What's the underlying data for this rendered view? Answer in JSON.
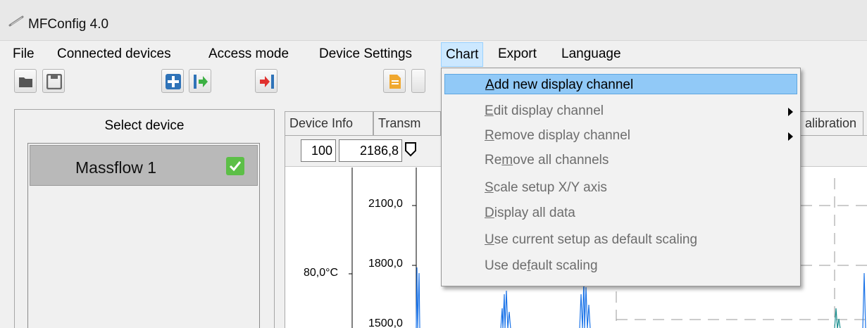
{
  "window": {
    "title": "MFConfig 4.0"
  },
  "menubar": [
    {
      "label": "File"
    },
    {
      "label": "Connected devices"
    },
    {
      "label": "Access mode"
    },
    {
      "label": "Device Settings"
    },
    {
      "label": "Chart",
      "active": true
    },
    {
      "label": "Export"
    },
    {
      "label": "Language"
    }
  ],
  "toolbar": {
    "buttons": [
      "open-folder-icon",
      "save-disk-icon",
      "add-device-icon",
      "connect-icon",
      "disconnect-icon",
      "document-icon"
    ]
  },
  "left_panel": {
    "header": "Select device",
    "devices": [
      {
        "name": "Massflow 1",
        "selected": true,
        "status_icon": "checkmark-icon"
      }
    ]
  },
  "tabs": [
    {
      "label": "Device Info"
    },
    {
      "label": "Transm"
    },
    {
      "label": "alibration"
    }
  ],
  "chart_toolbar": {
    "field1": "100",
    "field2": "2186,8"
  },
  "chart": {
    "y_ticks": [
      "2100,0",
      "1800,0",
      "1500,0"
    ],
    "secondary_label": "80,0°C",
    "series_color": "#1a73e8",
    "series_color_2": "#1a8f8f"
  },
  "chart_menu": {
    "items": [
      {
        "pre": "",
        "ul": "A",
        "post": "dd new display channel",
        "enabled": true,
        "highlighted": true,
        "submenu": false
      },
      {
        "pre": "",
        "ul": "E",
        "post": "dit display channel",
        "enabled": false,
        "highlighted": false,
        "submenu": true
      },
      {
        "pre": "",
        "ul": "R",
        "post": "emove display channel",
        "enabled": false,
        "highlighted": false,
        "submenu": true
      },
      {
        "pre": "Re",
        "ul": "m",
        "post": "ove all channels",
        "enabled": false,
        "highlighted": false,
        "submenu": false
      },
      {
        "pre": "",
        "ul": "S",
        "post": "cale setup X/Y axis",
        "enabled": false,
        "highlighted": false,
        "submenu": false
      },
      {
        "pre": "",
        "ul": "D",
        "post": "isplay all data",
        "enabled": false,
        "highlighted": false,
        "submenu": false
      },
      {
        "pre": "",
        "ul": "U",
        "post": "se current setup as default scaling",
        "enabled": false,
        "highlighted": false,
        "submenu": false
      },
      {
        "pre": "Use de",
        "ul": "f",
        "post": "ault scaling",
        "enabled": false,
        "highlighted": false,
        "submenu": false
      }
    ]
  }
}
